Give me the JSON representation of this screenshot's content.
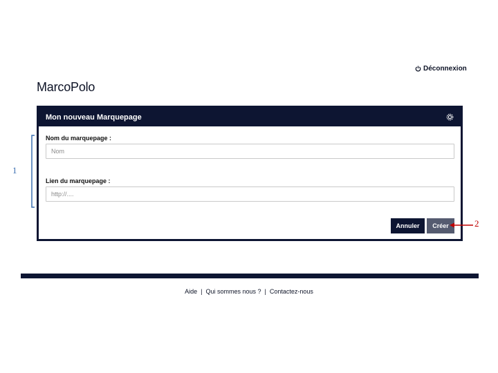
{
  "header": {
    "logout_label": "Déconnexion",
    "brand": "MarcoPolo"
  },
  "dialog": {
    "title": "Mon nouveau Marquepage",
    "fields": [
      {
        "label": "Nom du marquepage :",
        "placeholder": "Nom"
      },
      {
        "label": "Lien du marquepage :",
        "placeholder": "http://...."
      }
    ],
    "cancel_label": "Annuler",
    "create_label": "Créer"
  },
  "footer": {
    "links": [
      "Aide",
      "Qui sommes nous ?",
      "Contactez-nous"
    ],
    "separator": "|"
  },
  "annotations": {
    "fields_marker": "1",
    "create_marker": "2"
  },
  "colors": {
    "navy": "#0d1532",
    "create_button": "#555b70",
    "annotation_blue": "#3a6eb0",
    "annotation_red": "#c00000"
  }
}
